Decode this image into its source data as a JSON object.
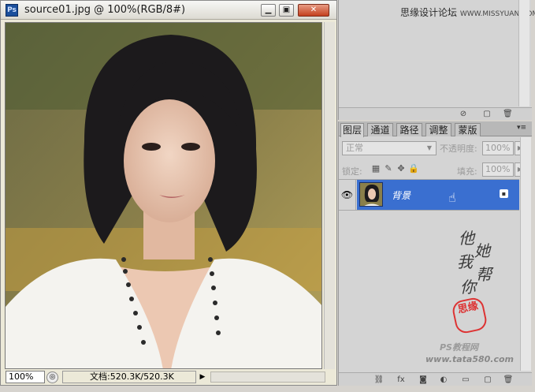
{
  "document": {
    "title": "source01.jpg @ 100%(RGB/8#)",
    "app_icon": "Ps",
    "window_buttons": {
      "minimize": "▁",
      "maximize": "▣",
      "close": "✕"
    }
  },
  "status_bar": {
    "zoom": "100%",
    "doc_info": "文档:520.3K/520.3K",
    "arrow": "▶"
  },
  "top_panel": {
    "watermark": "思缘设计论坛",
    "watermark_url": "WWW.MISSYUAN.COM"
  },
  "layers_panel": {
    "tabs": [
      "图层",
      "通道",
      "路径",
      "调整",
      "蒙版"
    ],
    "menu_icon": "▾≡",
    "blend_mode": "正常",
    "opacity_label": "不透明度:",
    "opacity_value": "100%",
    "lock_label": "锁定:",
    "fill_label": "填充:",
    "fill_value": "100%",
    "layer": {
      "name": "背景",
      "visible": true
    }
  },
  "annotations": {
    "handwriting": [
      "他",
      "她",
      "我",
      "帮",
      "你"
    ],
    "seal_text": "思缘",
    "site_line1": "PS教程网",
    "site_line2": "www.tata580.com"
  },
  "icons": {
    "eye": "eye-icon",
    "lock_transparent": "checker-lock-icon",
    "lock_paint": "brush-lock-icon",
    "lock_move": "move-lock-icon",
    "lock_all": "padlock-icon",
    "footer": [
      "link-icon",
      "fx-icon",
      "mask-icon",
      "adjustment-icon",
      "folder-icon",
      "new-layer-icon",
      "trash-icon"
    ]
  }
}
